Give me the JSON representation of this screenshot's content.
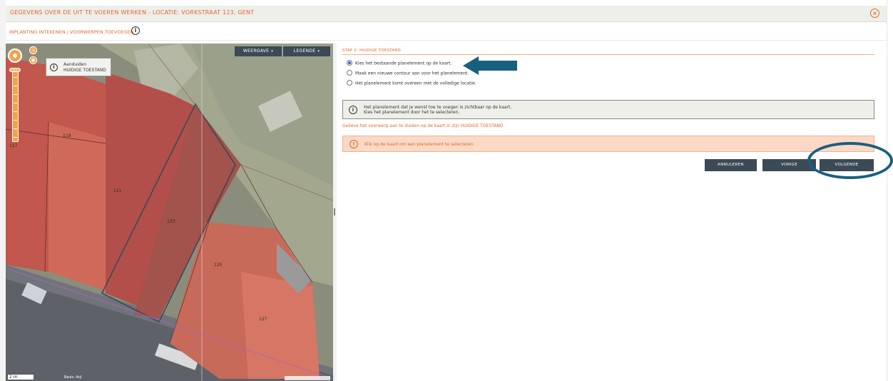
{
  "window": {
    "title": "GEGEVENS OVER DE UIT TE VOEREN WERKEN - LOCATIE: VORKSTRAAT 123, GENT",
    "subtitle": "INPLANTING INTEKENEN / VOORWERPEN TOEVOEGEN",
    "close_icon": "close-circle-icon"
  },
  "map": {
    "buttons": {
      "weergave": "WEERGAVE",
      "legende": "LEGENDE"
    },
    "tooltip": {
      "line1": "Aanduiden",
      "line2": "HUIDIGE TOESTAND"
    },
    "plot_numbers": [
      "117",
      "119",
      "121",
      "123",
      "125",
      "127"
    ],
    "scale_label": "2 m",
    "scale_label2": "Basis: Arji"
  },
  "step": {
    "title": "STAP 2: HUIDIGE TOESTAND",
    "options": [
      {
        "label": "Kies het bestaande planelement op de kaart.",
        "selected": true
      },
      {
        "label": "Maak een nieuwe contour aan voor het planelement.",
        "selected": false
      },
      {
        "label": "Het planelement komt overeen met de volledige locatie.",
        "selected": false
      }
    ],
    "info": {
      "line1": "Het planelement dat je wenst toe te voegen is zichtbaar op de kaart.",
      "line2": "Kies het planelement door het te selecteren."
    },
    "hint": "Gelieve het voorwerp aan te duiden op de kaart in zijn HUIDIGE TOESTAND",
    "warning": "Klik op de kaart om een planelement te selecteren."
  },
  "buttons": {
    "cancel": "ANNULEREN",
    "previous": "VORIGE",
    "next": "VOLGENDE"
  },
  "colors": {
    "accent": "#e06a2b",
    "button": "#3b4a56",
    "annotation": "#17607e",
    "warning_bg": "#fbd9c6"
  }
}
